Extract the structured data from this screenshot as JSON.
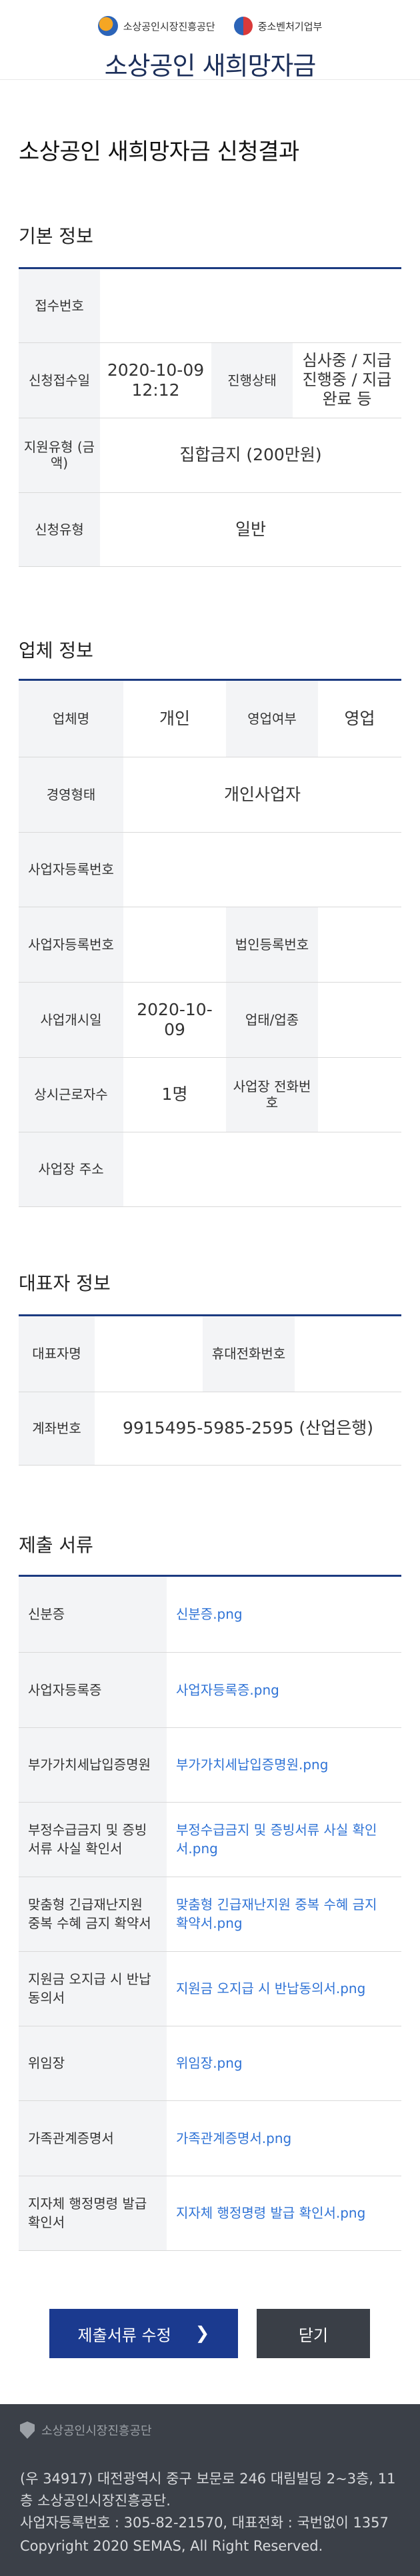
{
  "header": {
    "org1": "소상공인시장진흥공단",
    "org2": "중소벤처기업부",
    "app_title": "소상공인 새희망자금"
  },
  "page_title": "소상공인 새희망자금 신청결과",
  "basic": {
    "title": "기본 정보",
    "receipt_no_label": "접수번호",
    "receipt_no": "",
    "apply_date_label": "신청접수일",
    "apply_date": "2020-10-09 12:12",
    "status_label": "진행상태",
    "status": "심사중 / 지급 진행중 / 지급완료 등",
    "support_type_label": "지원유형 (금액)",
    "support_type": "집합금지 (200만원)",
    "apply_type_label": "신청유형",
    "apply_type": "일반"
  },
  "business": {
    "title": "업체 정보",
    "type_label": "업체명",
    "type_value": "개인",
    "operation_label": "영업여부",
    "operation_value": "영업",
    "form_label": "경영형태",
    "form_value": "개인사업자",
    "bizno_label": "사업자등록번호",
    "bizno_value": "",
    "bizno2_label": "사업자등록번호",
    "bizno2_value": "",
    "corpno_label": "법인등록번호",
    "corpno_value": "",
    "open_date_label": "사업개시일",
    "open_date": "2020-10-09",
    "industry_label": "업태/업종",
    "industry_value": "",
    "employees_label": "상시근로자수",
    "employees": "1명",
    "phone_label": "사업장 전화번호",
    "phone_value": "",
    "address_label": "사업장 주소",
    "address_value": ""
  },
  "rep": {
    "title": "대표자 정보",
    "name_label": "대표자명",
    "name_value": "",
    "mobile_label": "휴대전화번호",
    "mobile_value": "",
    "account_label": "계좌번호",
    "account_value": "9915495-5985-2595 (산업은행)"
  },
  "docs": {
    "title": "제출 서류",
    "items": [
      {
        "label": "신분증",
        "file": "신분증.png"
      },
      {
        "label": "사업자등록증",
        "file": "사업자등록증.png"
      },
      {
        "label": "부가가치세납입증명원",
        "file": "부가가치세납입증명원.png"
      },
      {
        "label": "부정수급금지 및 증빙서류 사실 확인서",
        "file": "부정수급금지 및 증빙서류 사실 확인서.png"
      },
      {
        "label": "맞춤형 긴급재난지원 중복 수혜 금지 확약서",
        "file": "맞춤형 긴급재난지원 중복 수혜 금지 확약서.png"
      },
      {
        "label": "지원금 오지급 시 반납동의서",
        "file": "지원금 오지급 시 반납동의서.png"
      },
      {
        "label": "위임장",
        "file": "위임장.png"
      },
      {
        "label": "가족관계증명서",
        "file": "가족관계증명서.png"
      },
      {
        "label": "지자체 행정명령 발급 확인서",
        "file": "지자체 행정명령 발급 확인서.png"
      }
    ]
  },
  "buttons": {
    "edit": "제출서류 수정",
    "close": "닫기"
  },
  "footer": {
    "org": "소상공인시장진흥공단",
    "address": "(우 34917) 대전광역시 중구 보문로 246 대림빌딩 2~3층, 11층 소상공인시장진흥공단.",
    "bizinfo": "사업자등록번호 : 305-82-21570, 대표전화 : 국번없이 1357",
    "copyright": "Copyright 2020 SEMAS, All Right Reserved."
  }
}
